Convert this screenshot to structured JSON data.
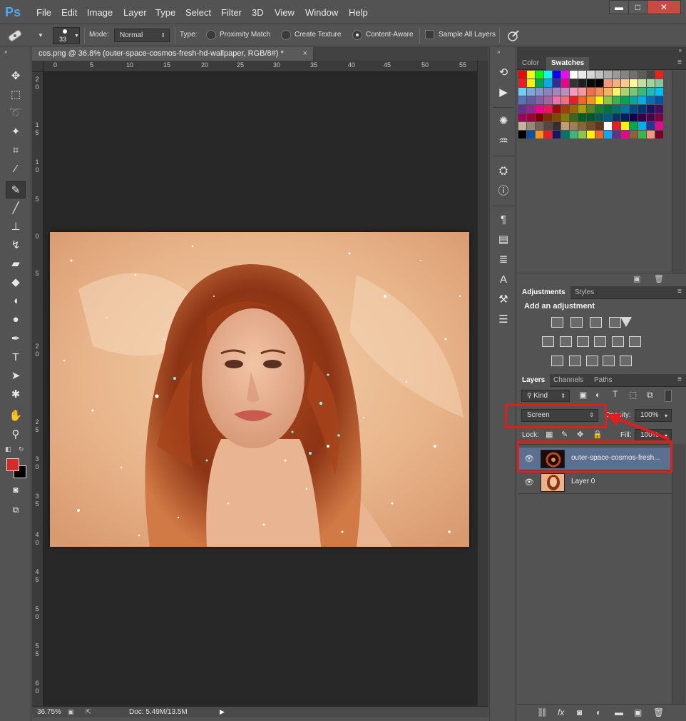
{
  "app": {
    "logo": "Ps"
  },
  "menu": [
    "File",
    "Edit",
    "Image",
    "Layer",
    "Type",
    "Select",
    "Filter",
    "3D",
    "View",
    "Window",
    "Help"
  ],
  "window_controls": {
    "minimize": "▬",
    "maximize": "□",
    "close": "✕"
  },
  "options": {
    "brush_size": "33",
    "mode_label": "Mode:",
    "mode_value": "Normal",
    "type_label": "Type:",
    "type_options": [
      "Proximity Match",
      "Create Texture",
      "Content-Aware"
    ],
    "type_selected": "Content-Aware",
    "sample_all_layers": "Sample All Layers"
  },
  "document": {
    "tab_title": "cos.png @ 36.8% (outer-space-cosmos-fresh-hd-wallpaper, RGB/8#) *",
    "close": "×",
    "ruler_h": [
      "0",
      "5",
      "10",
      "15",
      "20",
      "25",
      "30",
      "35",
      "40",
      "45",
      "50",
      "55"
    ],
    "ruler_v": [
      "2",
      "0",
      "1",
      "5",
      "1",
      "0",
      "5",
      "0",
      "5",
      "2",
      "0",
      "2",
      "5",
      "3",
      "0",
      "3",
      "5",
      "4",
      "0",
      "4",
      "5",
      "5",
      "0",
      "5",
      "5",
      "6",
      "0",
      "6",
      "5"
    ]
  },
  "status": {
    "zoom": "36.75%",
    "doc": "Doc: 5.49M/13.5M"
  },
  "panels": {
    "color_tabs": [
      "Color",
      "Swatches"
    ],
    "swatches_active": "Swatches",
    "adjust_tabs": [
      "Adjustments",
      "Styles"
    ],
    "adjustments_active": "Adjustments",
    "add_adjustment": "Add an adjustment",
    "layers_tabs": [
      "Layers",
      "Channels",
      "Paths"
    ],
    "layers_active": "Layers",
    "kind_label": "Kind",
    "blend_mode": "Screen",
    "opacity_label": "Opacity:",
    "opacity_value": "100%",
    "lock_label": "Lock:",
    "fill_label": "Fill:",
    "fill_value": "100%",
    "layers": [
      {
        "name": "outer-space-cosmos-fresh...",
        "selected": true
      },
      {
        "name": "Layer 0",
        "selected": false
      }
    ]
  },
  "colors": {
    "highlight": "#e41c1c",
    "foreground": "#d62b2b",
    "background": "#000000",
    "selected_layer": "#5b6f91"
  }
}
